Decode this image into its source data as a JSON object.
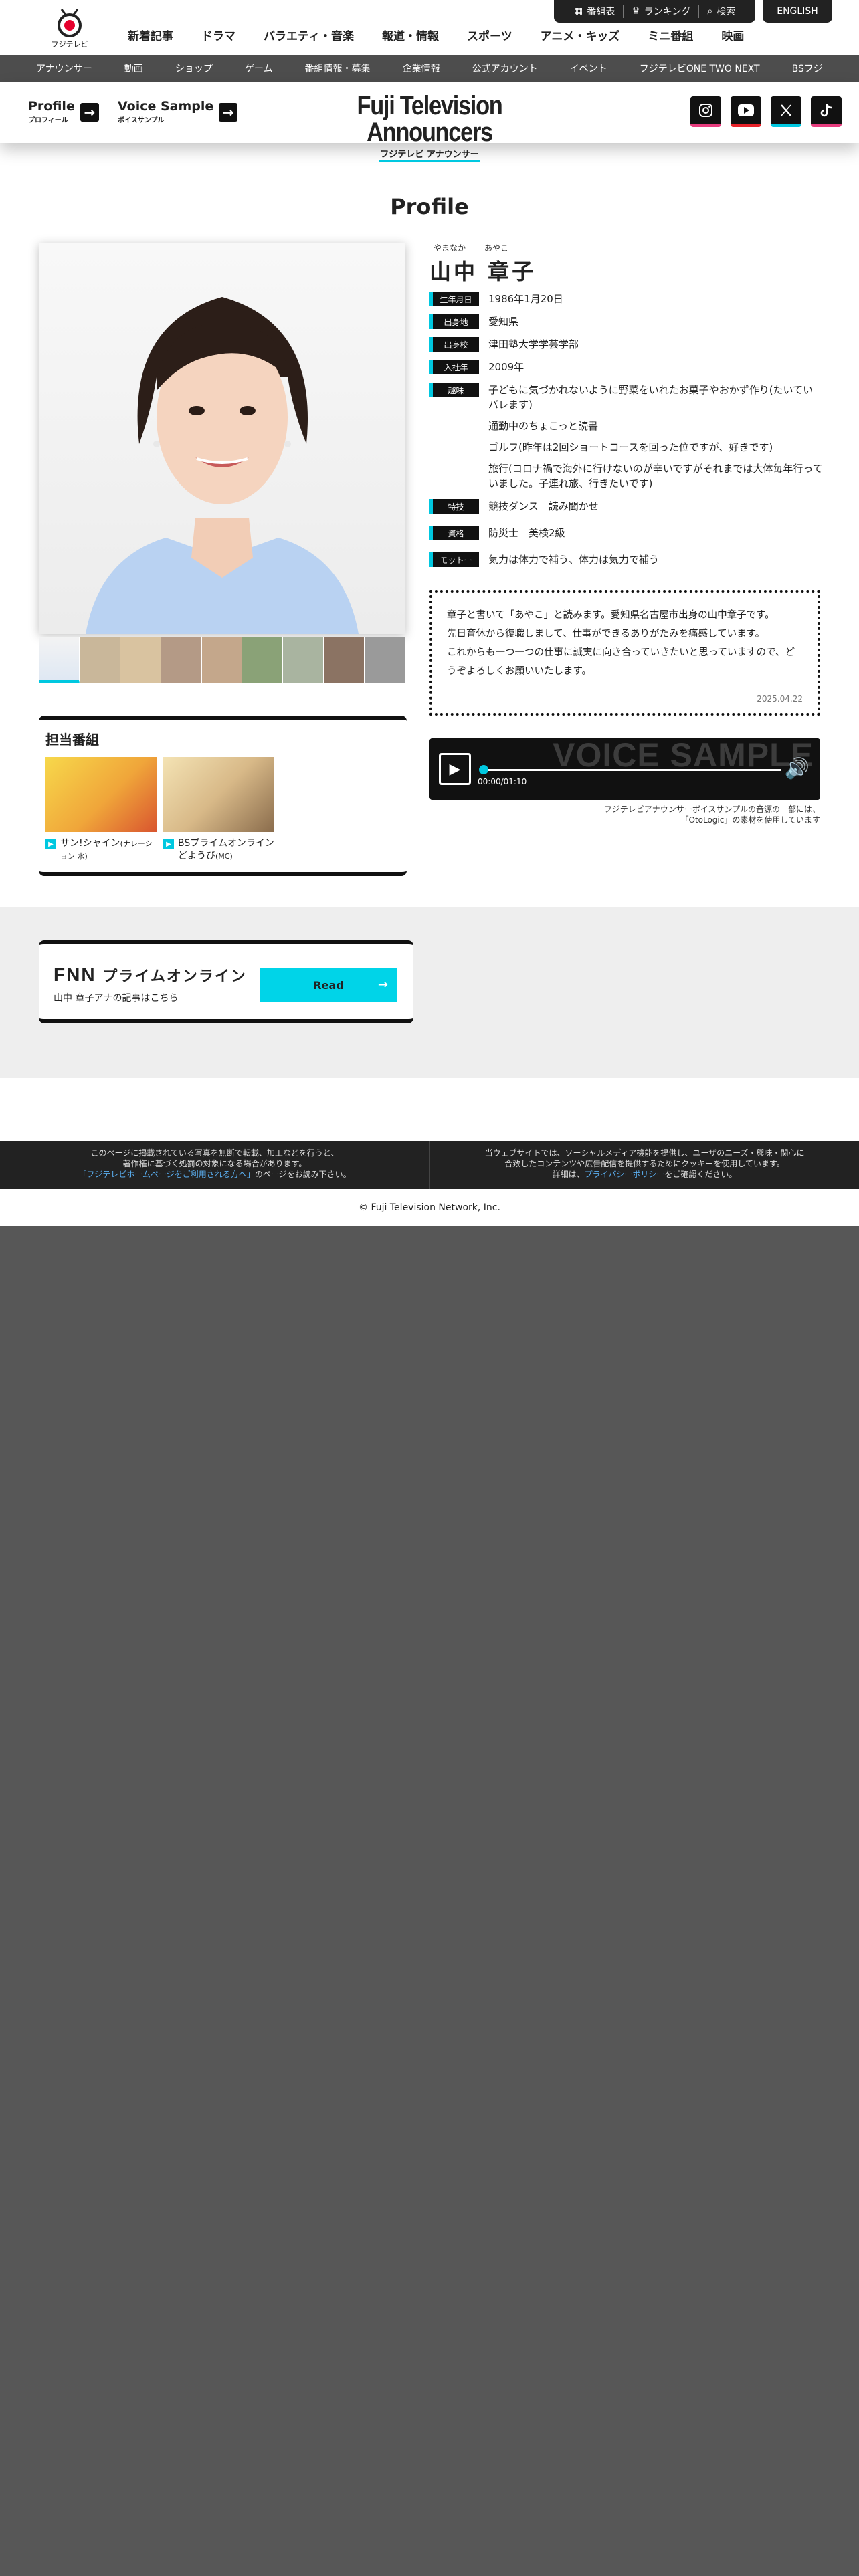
{
  "header": {
    "logo_text": "フジテレビ",
    "util": [
      "番組表",
      "ランキング",
      "検索"
    ],
    "english": "ENGLISH",
    "gnav": [
      "新着記事",
      "ドラマ",
      "バラエティ・音楽",
      "報道・情報",
      "スポーツ",
      "アニメ・キッズ",
      "ミニ番組",
      "映画"
    ],
    "subnav": [
      "アナウンサー",
      "動画",
      "ショップ",
      "ゲーム",
      "番組情報・募集",
      "企業情報",
      "公式アカウント",
      "イベント",
      "フジテレビONE TWO NEXT",
      "BSフジ"
    ]
  },
  "bar": {
    "profile_en": "Profile",
    "profile_ja": "プロフィール",
    "voice_en": "Voice Sample",
    "voice_ja": "ボイスサンプル",
    "brand_en": "Fuji Television Announcers",
    "brand_ja": "フジテレビ アナウンサー"
  },
  "profile": {
    "section_title": "Profile",
    "ruby_family": "やまなか",
    "ruby_given": "あやこ",
    "name": "山中 章子",
    "rows": [
      {
        "label": "生年月日",
        "value": "1986年1月20日"
      },
      {
        "label": "出身地",
        "value": "愛知県"
      },
      {
        "label": "出身校",
        "value": "津田塾大学学芸学部"
      },
      {
        "label": "入社年",
        "value": "2009年"
      }
    ],
    "hobby_label": "趣味",
    "hobbies": [
      "子どもに気づかれないように野菜をいれたお菓子やおかず作り(たいていバレます)",
      "通勤中のちょこっと読書",
      "ゴルフ(昨年は2回ショートコースを回った位ですが、好きです)",
      "旅行(コロナ禍で海外に行けないのが辛いですがそれまでは大体毎年行っていました。子連れ旅、行きたいです)"
    ],
    "skill_label": "特技",
    "skill": "競技ダンス　読み聞かせ",
    "license_label": "資格",
    "license": "防災士　美検2級",
    "motto_label": "モットー",
    "motto": "気力は体力で補う、体力は気力で補う"
  },
  "message": {
    "lines": [
      "章子と書いて「あやこ」と読みます。愛知県名古屋市出身の山中章子です。",
      "先日育休から復職しまして、仕事ができるありがたみを痛感しています。",
      "これからも一つ一つの仕事に誠実に向き合っていきたいと思っていますので、どうぞよろしくお願いいたします。"
    ],
    "date": "2025.04.22"
  },
  "voice": {
    "title": "VOICE SAMPLE",
    "time": "00:00/01:10",
    "progress": 0,
    "note_1": "フジテレビアナウンサーボイスサンプルの音源の一部には、",
    "note_2": "「OtoLogic」の素材を使用しています"
  },
  "shows": {
    "title": "担当番組",
    "items": [
      {
        "name": "サン!シャイン",
        "role": "(ナレーション 水)"
      },
      {
        "name": "BSプライムオンライン どようび",
        "role": "(MC)"
      }
    ]
  },
  "fnn": {
    "logo": "FNN",
    "logo_sub": "プライムオンライン",
    "sub": "山中 章子アナの記事はこちら",
    "read": "Read"
  },
  "footer": {
    "left_1": "このページに掲載されている写真を無断で転載、加工などを行うと、",
    "left_2": "著作権に基づく処罰の対象になる場合があります。",
    "left_link": "「フジテレビホームページをご利用される方へ」",
    "left_3": "のページをお読み下さい。",
    "right_1": "当ウェブサイトでは、ソーシャルメディア機能を提供し、ユーザのニーズ・興味・関心に",
    "right_2": "合致したコンテンツや広告配信を提供するためにクッキーを使用しています。",
    "right_3": "詳細は、",
    "right_link": "プライバシーポリシー",
    "right_4": "をご確認ください。",
    "copyright": "© Fuji Television Network, Inc."
  },
  "colors": {
    "accent": "#00c8e0",
    "dark": "#111111",
    "bg_gray": "#575757"
  }
}
